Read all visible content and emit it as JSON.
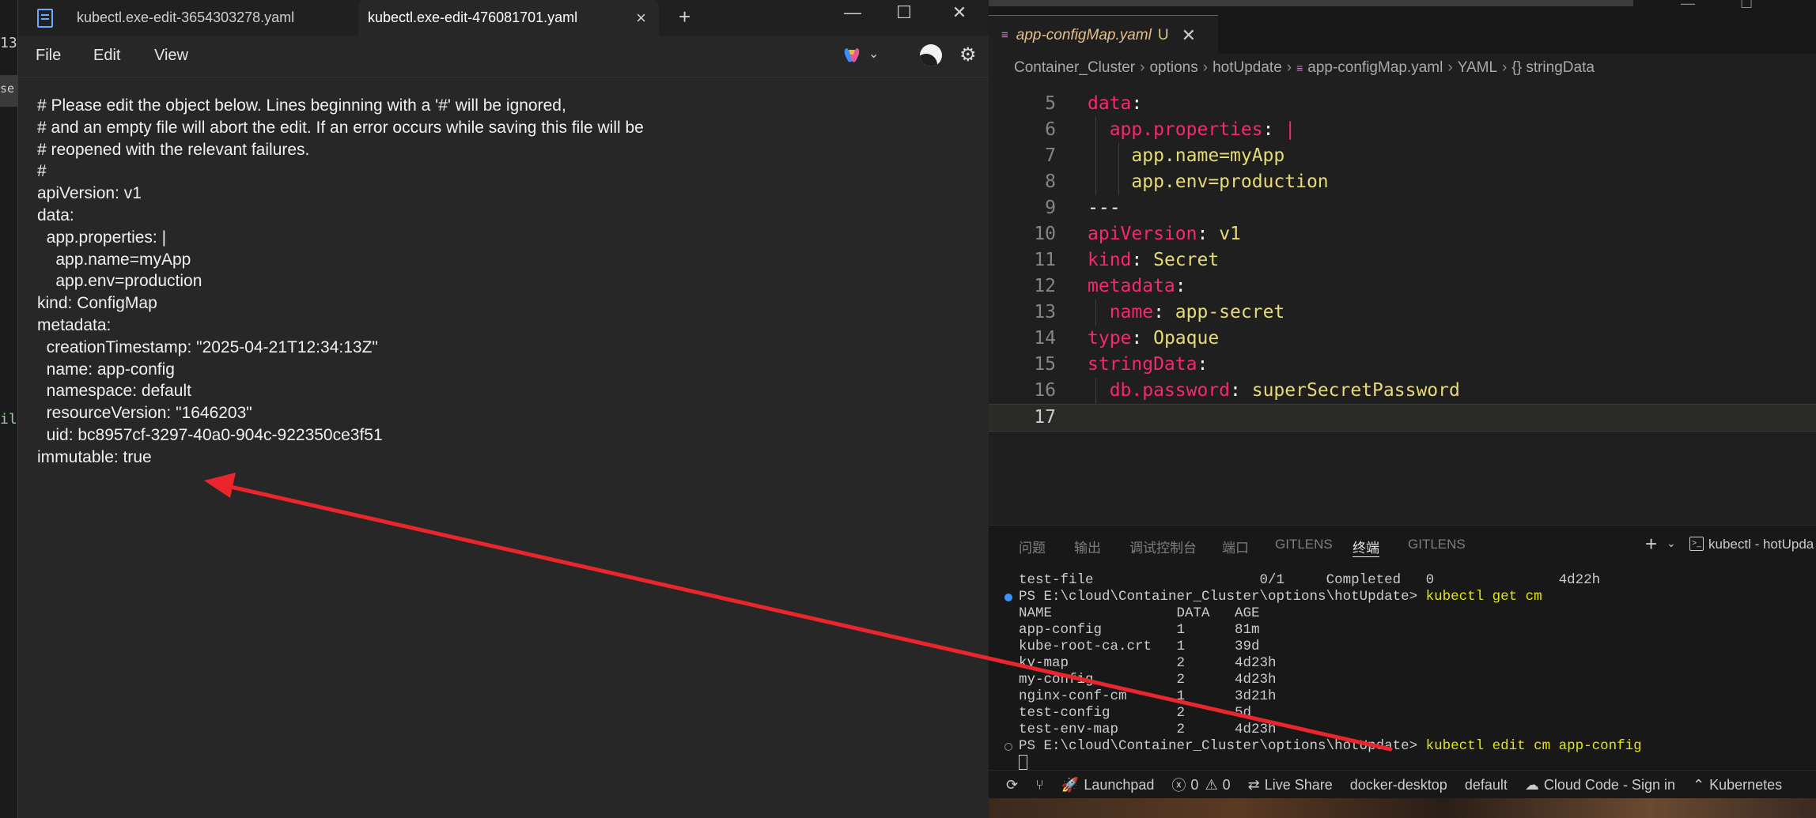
{
  "edge": {
    "fragments": [
      "13",
      "se",
      "il",
      "s"
    ]
  },
  "notepad": {
    "tabs": [
      {
        "label": "kubectl.exe-edit-3654303278.yaml"
      },
      {
        "label": "kubectl.exe-edit-476081701.yaml",
        "active": true
      }
    ],
    "close_tab_glyph": "×",
    "new_tab_glyph": "+",
    "window_controls": {
      "minimize": "—",
      "maximize": "☐",
      "close": "✕"
    },
    "menu": {
      "file": "File",
      "edit": "Edit",
      "view": "View"
    },
    "content": "# Please edit the object below. Lines beginning with a '#' will be ignored,\n# and an empty file will abort the edit. If an error occurs while saving this file will be\n# reopened with the relevant failures.\n#\napiVersion: v1\ndata:\n  app.properties: |\n    app.name=myApp\n    app.env=production\nkind: ConfigMap\nmetadata:\n  creationTimestamp: \"2025-04-21T12:34:13Z\"\n  name: app-config\n  namespace: default\n  resourceVersion: \"1646203\"\n  uid: bc8957cf-3297-40a0-904c-922350ce3f51\nimmutable: true"
  },
  "vscode": {
    "tab": {
      "name": "app-configMap.yaml",
      "status": "U",
      "close": "✕",
      "yaml_mark": "≡"
    },
    "breadcrumb": [
      "Container_Cluster",
      "options",
      "hotUpdate",
      "app-configMap.yaml",
      "YAML",
      "{} stringData"
    ],
    "code_lines": [
      {
        "n": "5",
        "parts": [
          [
            "k",
            "data"
          ],
          [
            "p",
            ":"
          ]
        ]
      },
      {
        "n": "6",
        "parts": [
          [
            "d",
            "  "
          ],
          [
            "k",
            "app.properties"
          ],
          [
            "p",
            ": "
          ],
          [
            "k",
            "|"
          ]
        ]
      },
      {
        "n": "7",
        "parts": [
          [
            "d",
            "    "
          ],
          [
            "v",
            "app.name=myApp"
          ]
        ]
      },
      {
        "n": "8",
        "parts": [
          [
            "d",
            "    "
          ],
          [
            "v",
            "app.env=production"
          ]
        ]
      },
      {
        "n": "9",
        "parts": [
          [
            "d",
            "---"
          ]
        ]
      },
      {
        "n": "10",
        "parts": [
          [
            "k",
            "apiVersion"
          ],
          [
            "p",
            ": "
          ],
          [
            "v",
            "v1"
          ]
        ]
      },
      {
        "n": "11",
        "parts": [
          [
            "k",
            "kind"
          ],
          [
            "p",
            ": "
          ],
          [
            "v",
            "Secret"
          ]
        ]
      },
      {
        "n": "12",
        "parts": [
          [
            "k",
            "metadata"
          ],
          [
            "p",
            ":"
          ]
        ]
      },
      {
        "n": "13",
        "parts": [
          [
            "d",
            "  "
          ],
          [
            "k",
            "name"
          ],
          [
            "p",
            ": "
          ],
          [
            "v",
            "app-secret"
          ]
        ]
      },
      {
        "n": "14",
        "parts": [
          [
            "k",
            "type"
          ],
          [
            "p",
            ": "
          ],
          [
            "v",
            "Opaque"
          ]
        ]
      },
      {
        "n": "15",
        "parts": [
          [
            "k",
            "stringData"
          ],
          [
            "p",
            ":"
          ]
        ]
      },
      {
        "n": "16",
        "parts": [
          [
            "d",
            "  "
          ],
          [
            "k",
            "db.password"
          ],
          [
            "p",
            ": "
          ],
          [
            "v",
            "superSecretPassword"
          ]
        ]
      },
      {
        "n": "17",
        "parts": []
      }
    ],
    "panel_tabs": [
      "问题",
      "输出",
      "调试控制台",
      "端口",
      "GITLENS",
      "终端",
      "GITLENS"
    ],
    "active_panel_tab": "终端",
    "terminal_title": "kubectl - hotUpda",
    "terminal": {
      "prev_line": "test-file                    0/1     Completed   0               4d22h",
      "prompt1": "PS E:\\cloud\\Container_Cluster\\options\\hotUpdate> ",
      "cmd1": "kubectl get cm",
      "header": "NAME               DATA   AGE",
      "rows": [
        "app-config         1      81m",
        "kube-root-ca.crt   1      39d",
        "kv-map             2      4d23h",
        "my-config          2      4d23h",
        "nginx-conf-cm      1      3d21h",
        "test-config        2      5d",
        "test-env-map       2      4d23h"
      ],
      "prompt2": "PS E:\\cloud\\Container_Cluster\\options\\hotUpdate> ",
      "cmd2": "kubectl edit cm app-config"
    },
    "status_bar": {
      "launchpad": "Launchpad",
      "problems": "0",
      "warnings": "0",
      "live_share": "Live Share",
      "context": "docker-desktop",
      "namespace": "default",
      "cloud_code": "Cloud Code - Sign in",
      "kubernetes": "Kubernetes"
    }
  },
  "colors": {
    "yaml_key": "#f92672",
    "yaml_value": "#e6db74",
    "arrow": "#e8262b",
    "terminal_command": "#e5e510",
    "vs_accent": "#0078d4"
  }
}
